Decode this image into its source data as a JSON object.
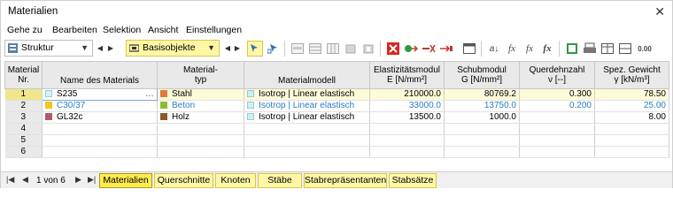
{
  "window": {
    "title": "Materialien"
  },
  "menu": [
    "Gehe zu",
    "Bearbeiten",
    "Selektion",
    "Ansicht",
    "Einstellungen"
  ],
  "toolbar": {
    "combo1": "Struktur",
    "combo2": "Basisobjekte",
    "numeric_label": "0.00"
  },
  "table": {
    "headers": {
      "nr_l1": "Material",
      "nr_l2": "Nr.",
      "name": "Name des Materials",
      "type_l1": "Material-",
      "type_l2": "typ",
      "model": "Materialmodell",
      "e_l1": "Elastizitätsmodul",
      "e_l2": "E [N/mm²]",
      "g_l1": "Schubmodul",
      "g_l2": "G [N/mm²]",
      "v_l1": "Querdehnzahl",
      "v_l2": "ν [--]",
      "w_l1": "Spez. Gewicht",
      "w_l2": "γ [kN/m³]"
    },
    "rows": [
      {
        "nr": "1",
        "name": "S235",
        "type": "Stahl",
        "type_color": "#e07b39",
        "name_color": "#d8f0f8",
        "model": "Isotrop | Linear elastisch",
        "e": "210000.0",
        "g": "80769.2",
        "v": "0.300",
        "w": "78.50"
      },
      {
        "nr": "2",
        "name": "C30/37",
        "type": "Beton",
        "type_color": "#8cbd2f",
        "name_color": "#f5c518",
        "model": "Isotrop | Linear elastisch",
        "e": "33000.0",
        "g": "13750.0",
        "v": "0.200",
        "w": "25.00"
      },
      {
        "nr": "3",
        "name": "GL32c",
        "type": "Holz",
        "type_color": "#8b5a2b",
        "name_color": "#b05a6b",
        "model": "Isotrop | Linear elastisch",
        "e": "13500.0",
        "g": "1000.0",
        "v": "",
        "w": "8.00"
      },
      {
        "nr": "4"
      },
      {
        "nr": "5"
      },
      {
        "nr": "6"
      }
    ]
  },
  "pager": {
    "text": "1 von 6"
  },
  "tabs": [
    "Materialien",
    "Querschnitte",
    "Knoten",
    "Stäbe",
    "Stabrepräsentanten",
    "Stabsätze"
  ]
}
